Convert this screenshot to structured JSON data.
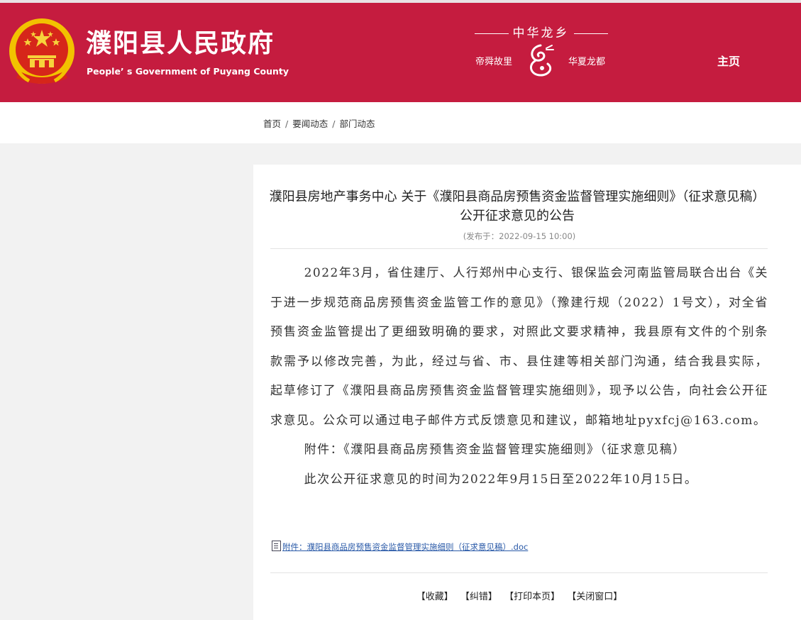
{
  "header": {
    "title": "濮阳县人民政府",
    "subtitle": "People’ s Government of Puyang County",
    "motto_title": "中华龙乡",
    "motto_left": "帝舜故里",
    "motto_right": "华夏龙都",
    "home_link": "主页",
    "colors": {
      "brand_red": "#c51c3f",
      "gold": "#f2c200"
    },
    "icons": {
      "emblem": "national-emblem-icon",
      "dragon": "dragon-icon"
    }
  },
  "breadcrumb": {
    "items": [
      "首页",
      "要闻动态",
      "部门动态"
    ],
    "separator": "/"
  },
  "article": {
    "title": "濮阳县房地产事务中心 关于《濮阳县商品房预售资金监督管理实施细则》（征求意见稿）公开征求意见的公告",
    "date": "(发布于：2022-09-15 10:00)",
    "paragraphs": [
      "2022年3月，省住建厅、人行郑州中心支行、银保监会河南监管局联合出台《关于进一步规范商品房预售资金监管工作的意见》（豫建行规（2022）1号文），对全省预售资金监管提出了更细致明确的要求，对照此文要求精神，我县原有文件的个别条款需予以修改完善，为此，经过与省、市、县住建等相关部门沟通，结合我县实际，起草修订了《濮阳县商品房预售资金监督管理实施细则》，现予以公告，向社会公开征求意见。公众可以通过电子邮件方式反馈意见和建议，邮箱地址pyxfcj@163.com。",
      "附件：《濮阳县商品房预售资金监督管理实施细则》（征求意见稿）",
      "此次公开征求意见的时间为2022年9月15日至2022年10月15日。"
    ],
    "attachment": "附件：濮阳县商品房预售资金监督管理实施细则（征求意见稿）.doc",
    "tools": [
      "【收藏】",
      "【纠错】",
      "【打印本页】",
      "【关闭窗口】"
    ]
  }
}
